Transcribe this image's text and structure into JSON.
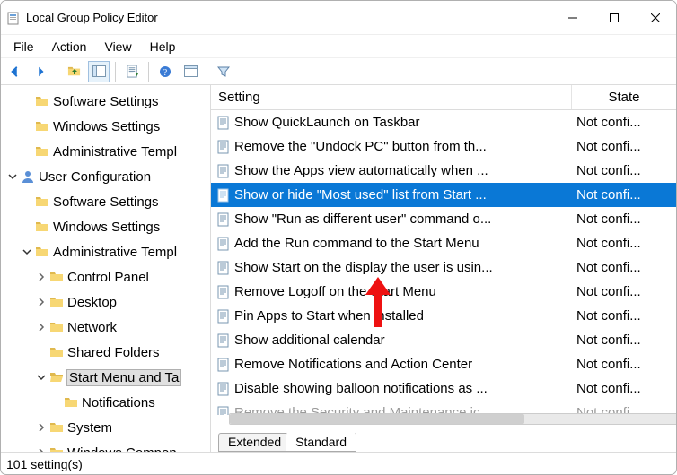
{
  "title": "Local Group Policy Editor",
  "menus": {
    "file": "File",
    "action": "Action",
    "view": "View",
    "help": "Help"
  },
  "toolbar_icons": [
    "back-icon",
    "forward-icon",
    "up-folder-icon",
    "show-hide-tree-icon",
    "export-list-icon",
    "help-icon",
    "properties-icon",
    "filter-icon"
  ],
  "tree": [
    {
      "level": 0,
      "expander": "",
      "icon": "folder",
      "label": "Software Settings"
    },
    {
      "level": 0,
      "expander": "",
      "icon": "folder",
      "label": "Windows Settings"
    },
    {
      "level": 0,
      "expander": "",
      "icon": "folder",
      "label": "Administrative Templ"
    },
    {
      "level": -1,
      "expander": "open",
      "icon": "user",
      "label": "User Configuration"
    },
    {
      "level": 0,
      "expander": "",
      "icon": "folder",
      "label": "Software Settings"
    },
    {
      "level": 0,
      "expander": "",
      "icon": "folder",
      "label": "Windows Settings"
    },
    {
      "level": 0,
      "expander": "open",
      "icon": "folder",
      "label": "Administrative Templ"
    },
    {
      "level": 1,
      "expander": "closed",
      "icon": "folder",
      "label": "Control Panel"
    },
    {
      "level": 1,
      "expander": "closed",
      "icon": "folder",
      "label": "Desktop"
    },
    {
      "level": 1,
      "expander": "closed",
      "icon": "folder",
      "label": "Network"
    },
    {
      "level": 1,
      "expander": "",
      "icon": "folder",
      "label": "Shared Folders"
    },
    {
      "level": 1,
      "expander": "open",
      "icon": "folder-open",
      "label": "Start Menu and Ta",
      "selected": true
    },
    {
      "level": 2,
      "expander": "",
      "icon": "folder",
      "label": "Notifications"
    },
    {
      "level": 1,
      "expander": "closed",
      "icon": "folder",
      "label": "System"
    },
    {
      "level": 1,
      "expander": "closed",
      "icon": "folder",
      "label": "Windows Compon"
    }
  ],
  "columns": {
    "setting": "Setting",
    "state": "State"
  },
  "state_value": "Not confi...",
  "settings": [
    {
      "label": "Show QuickLaunch on Taskbar"
    },
    {
      "label": "Remove the \"Undock PC\" button from th..."
    },
    {
      "label": "Show the Apps view automatically when ..."
    },
    {
      "label": "Show or hide \"Most used\" list from Start ...",
      "selected": true
    },
    {
      "label": "Show \"Run as different user\" command o..."
    },
    {
      "label": "Add the Run command to the Start Menu"
    },
    {
      "label": "Show Start on the display the user is usin..."
    },
    {
      "label": "Remove Logoff on the Start Menu"
    },
    {
      "label": "Pin Apps to Start when installed"
    },
    {
      "label": "Show additional calendar"
    },
    {
      "label": "Remove Notifications and Action Center"
    },
    {
      "label": "Disable showing balloon notifications as ..."
    },
    {
      "label": "Remove the Security and Maintenance ic",
      "faded": true
    }
  ],
  "tabs": {
    "extended": "Extended",
    "standard": "Standard"
  },
  "status": "101 setting(s)"
}
